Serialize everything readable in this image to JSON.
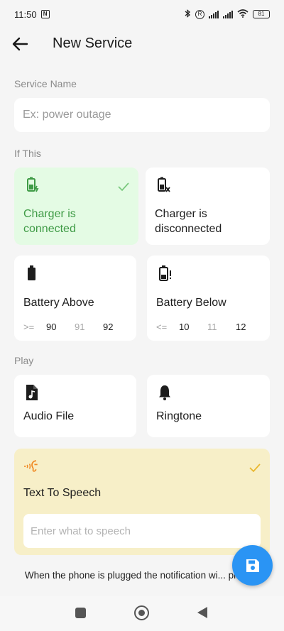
{
  "status_bar": {
    "time": "11:50",
    "battery_level": "81",
    "icons": [
      "nfc-icon",
      "bluetooth-icon",
      "registered-icon",
      "signal-icon",
      "signal-icon",
      "wifi-icon",
      "battery-icon"
    ]
  },
  "app_bar": {
    "title": "New Service",
    "back_icon": "arrow-left-icon"
  },
  "service_name": {
    "label": "Service Name",
    "placeholder": "Ex: power outage",
    "value": ""
  },
  "if_this": {
    "label": "If This",
    "conditions": [
      {
        "label": "Charger is connected",
        "icon": "battery-charging-icon",
        "selected": true
      },
      {
        "label": "Charger is disconnected",
        "icon": "battery-unplugged-icon",
        "selected": false
      },
      {
        "label": "Battery Above",
        "icon": "battery-full-icon",
        "selected": false,
        "operator": ">=",
        "values": [
          "90",
          "91",
          "92"
        ]
      },
      {
        "label": "Battery Below",
        "icon": "battery-alert-icon",
        "selected": false,
        "operator": "<=",
        "values": [
          "10",
          "11",
          "12"
        ]
      }
    ]
  },
  "play": {
    "label": "Play",
    "options": [
      {
        "label": "Audio File",
        "icon": "audio-file-icon",
        "selected": false
      },
      {
        "label": "Ringtone",
        "icon": "bell-icon",
        "selected": false
      },
      {
        "label": "Text To Speech",
        "icon": "speech-icon",
        "selected": true,
        "placeholder": "Enter what to speech"
      }
    ]
  },
  "footer": {
    "text": "When the phone is plugged the notification wi... played."
  },
  "fab": {
    "icon": "save-icon"
  },
  "colors": {
    "accent": "#2a94f4",
    "selected_green_bg": "#e4fbe4",
    "selected_green_text": "#3f9b46",
    "selected_yellow_bg": "#f7efc8",
    "check_yellow": "#e9b72e"
  }
}
